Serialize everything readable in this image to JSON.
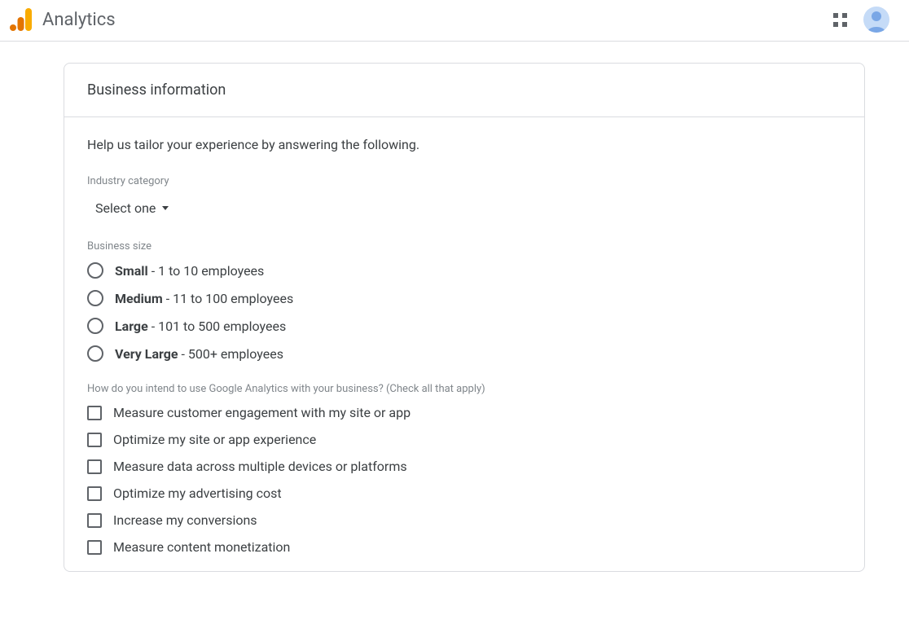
{
  "header": {
    "app_title": "Analytics"
  },
  "panel": {
    "title": "Business information",
    "intro": "Help us tailor your experience by answering the following.",
    "industry": {
      "label": "Industry category",
      "select_text": "Select one"
    },
    "size": {
      "label": "Business size",
      "options": [
        {
          "bold": "Small",
          "rest": " - 1 to 10 employees"
        },
        {
          "bold": "Medium",
          "rest": " - 11 to 100 employees"
        },
        {
          "bold": "Large",
          "rest": " - 101 to 500 employees"
        },
        {
          "bold": "Very Large",
          "rest": " - 500+ employees"
        }
      ]
    },
    "intent": {
      "label": "How do you intend to use Google Analytics with your business? (Check all that apply)",
      "options": [
        "Measure customer engagement with my site or app",
        "Optimize my site or app experience",
        "Measure data across multiple devices or platforms",
        "Optimize my advertising cost",
        "Increase my conversions",
        "Measure content monetization"
      ]
    }
  }
}
